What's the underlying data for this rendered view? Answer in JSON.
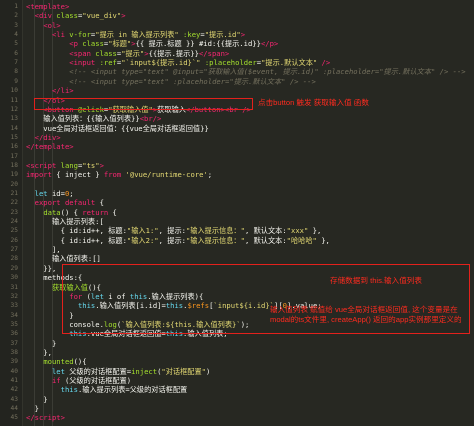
{
  "lines": [
    {
      "n": "1",
      "html": "<span class='t'>&lt;template&gt;</span>"
    },
    {
      "n": "2",
      "html": "  <span class='t'>&lt;div</span> <span class='a'>class</span>=<span class='s'>\"vue_div\"</span><span class='t'>&gt;</span>"
    },
    {
      "n": "3",
      "html": "    <span class='t'>&lt;ol&gt;</span>"
    },
    {
      "n": "4",
      "html": "      <span class='t'>&lt;li</span> <span class='a'>v-for</span>=<span class='s'>\"提示 in 输入提示列表\"</span> <span class='a'>:key</span>=<span class='s'>\"提示.id\"</span><span class='t'>&gt;</span>"
    },
    {
      "n": "5",
      "html": "          <span class='t'>&lt;p</span> <span class='a'>class</span>=<span class='s'>\"标题\"</span><span class='t'>&gt;</span>{{ 提示.标题 }} #id:{{提示.id}}<span class='t'>&lt;/p&gt;</span>"
    },
    {
      "n": "6",
      "html": "          <span class='t'>&lt;span</span> <span class='a'>class</span>=<span class='s'>\"提示\"</span><span class='t'>&gt;</span>{{提示.提示}}<span class='t'>&lt;/span&gt;</span>"
    },
    {
      "n": "7",
      "html": "          <span class='t'>&lt;input</span> <span class='a'>:ref</span>=<span class='s'>\"`input${提示.id}`\"</span> <span class='a'>:placeholder</span>=<span class='s'>\"提示.默认文本\"</span> <span class='t'>/&gt;</span>"
    },
    {
      "n": "8",
      "html": "          <span class='c'>&lt;!-- &lt;input type=\"text\" @input=\"获取输入值($event, 提示.id)\" :placeholder=\"提示.默认文本\" /&gt; --&gt;</span>"
    },
    {
      "n": "9",
      "html": "          <span class='c'>&lt;!-- &lt;input type=\"text\" :placeholder=\"提示.默认文本\" /&gt; --&gt;</span>"
    },
    {
      "n": "10",
      "html": "      <span class='t'>&lt;/li&gt;</span>"
    },
    {
      "n": "11",
      "html": "    <span class='t'>&lt;/ol&gt;</span>"
    },
    {
      "n": "12",
      "html": "    <span class='t'>&lt;button</span> <span class='a'>@click</span>=<span class='s'>\"获取输入值\"</span><span class='t'>&gt;</span>获取输入<span class='t'>&lt;/button&gt;&lt;br</span> <span class='t'>/&gt;</span>"
    },
    {
      "n": "13",
      "html": "    输入值列表：{{输入值列表}}<span class='t'>&lt;br/&gt;</span>"
    },
    {
      "n": "14",
      "html": "    vue全局对话框返回值：{{vue全局对话框返回值}}"
    },
    {
      "n": "15",
      "html": "  <span class='t'>&lt;/div&gt;</span>"
    },
    {
      "n": "16",
      "html": "<span class='t'>&lt;/template&gt;</span>"
    },
    {
      "n": "17",
      "html": ""
    },
    {
      "n": "18",
      "html": "<span class='t'>&lt;script</span> <span class='a'>lang</span>=<span class='s'>\"ts\"</span><span class='t'>&gt;</span>"
    },
    {
      "n": "19",
      "html": "<span class='t'>import</span> { inject } <span class='t'>from</span> <span class='s'>'@vue/runtime-core'</span>;"
    },
    {
      "n": "20",
      "html": ""
    },
    {
      "n": "21",
      "html": "  <span class='v'>let</span> id=<span class='o'>0</span>;"
    },
    {
      "n": "22",
      "html": "  <span class='t'>export default</span> {"
    },
    {
      "n": "23",
      "html": "    <span class='a'>data</span>() { <span class='t'>return</span> {"
    },
    {
      "n": "24",
      "html": "      输入提示列表:["
    },
    {
      "n": "25",
      "html": "        { id:id++, 标题:<span class='s'>\"输入1:\"</span>, 提示:<span class='s'>\"输入提示信息：\"</span>, 默认文本:<span class='s'>\"xxx\"</span> },"
    },
    {
      "n": "26",
      "html": "        { id:id++, 标题:<span class='s'>\"输入2:\"</span>, 提示:<span class='s'>\"输入提示信息：\"</span>, 默认文本:<span class='s'>\"哈哈哈\"</span> },"
    },
    {
      "n": "27",
      "html": "      ],"
    },
    {
      "n": "28",
      "html": "      输入值列表:[]"
    },
    {
      "n": "29",
      "html": "    }},"
    },
    {
      "n": "30",
      "html": "    methods:{"
    },
    {
      "n": "31",
      "html": "      <span class='a'>获取输入值</span>(){"
    },
    {
      "n": "32",
      "html": "          <span class='t'>for</span> (<span class='v'>let</span> i of <span class='v'>this</span>.输入提示列表){"
    },
    {
      "n": "33",
      "html": "            <span class='v'>this</span>.输入值列表[i.id]=<span class='v'>this</span>.<span class='o'>$refs</span>[<span class='s'>`input${i.id}`</span>][<span class='o'>0</span>].value;"
    },
    {
      "n": "34",
      "html": "          }"
    },
    {
      "n": "35",
      "html": "          console.<span class='a'>log</span>(<span class='s'>`输入值列表:${this.输入值列表}`</span>);"
    },
    {
      "n": "36",
      "html": "          <span class='v'>this</span>.vue全局对话框返回值=<span class='v'>this</span>.输入值列表;"
    },
    {
      "n": "37",
      "html": "      }"
    },
    {
      "n": "38",
      "html": "    },"
    },
    {
      "n": "39",
      "html": "    <span class='a'>mounted</span>(){"
    },
    {
      "n": "40",
      "html": "      <span class='v'>let</span> 父级的对话框配置=<span class='a'>inject</span>(<span class='s'>\"对话框配置\"</span>)"
    },
    {
      "n": "41",
      "html": "      <span class='t'>if</span> (父级的对话框配置)"
    },
    {
      "n": "42",
      "html": "        <span class='v'>this</span>.输入提示列表=父级的对话框配置"
    },
    {
      "n": "43",
      "html": "    }"
    },
    {
      "n": "44",
      "html": "  }"
    },
    {
      "n": "45",
      "html": "<span class='t'>&lt;/script&gt;</span>"
    }
  ],
  "annotations": {
    "note1": "点击button 触发 获取输入值 函数",
    "note2": "存储数据到 this.输入值列表",
    "note3": "输入值列表 赋值给 vue全局对话框返回值, 这个变量是在\nmodal的ts文件里, createApp() 返回的app实例那里定义的"
  },
  "colors": {
    "background": "#272822",
    "annotation": "#ff2b1f",
    "highlight_border": "#e3211c"
  }
}
